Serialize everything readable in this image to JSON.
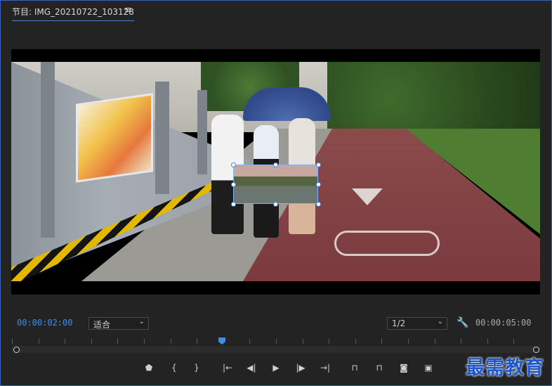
{
  "panel": {
    "title": "节目: IMG_20210722_103128",
    "menu_icon": "hamburger-icon"
  },
  "viewer": {
    "timecode_current": "00:00:02:00",
    "timecode_duration": "00:00:05:00",
    "zoom": {
      "selected": "适合"
    },
    "resolution": {
      "selected": "1/2"
    },
    "settings_icon": "wrench-icon"
  },
  "controls": [
    {
      "name": "add-marker-icon",
      "glyph": "⬟"
    },
    {
      "name": "mark-in-icon",
      "glyph": "{"
    },
    {
      "name": "mark-out-icon",
      "glyph": "}"
    },
    {
      "name": "go-to-in-icon",
      "glyph": "|←"
    },
    {
      "name": "step-back-icon",
      "glyph": "◀|"
    },
    {
      "name": "play-icon",
      "glyph": "▶"
    },
    {
      "name": "step-forward-icon",
      "glyph": "|▶"
    },
    {
      "name": "go-to-out-icon",
      "glyph": "→|"
    },
    {
      "name": "lift-icon",
      "glyph": "⊓"
    },
    {
      "name": "extract-icon",
      "glyph": "⊓"
    },
    {
      "name": "export-frame-icon",
      "glyph": "◙"
    },
    {
      "name": "compare-icon",
      "glyph": "▣"
    }
  ],
  "playhead_fraction": 0.4,
  "watermark": "最需教育",
  "colors": {
    "accent": "#3b8fe6",
    "panel_border": "#3a63b8",
    "watermark": "#1f57c8"
  }
}
